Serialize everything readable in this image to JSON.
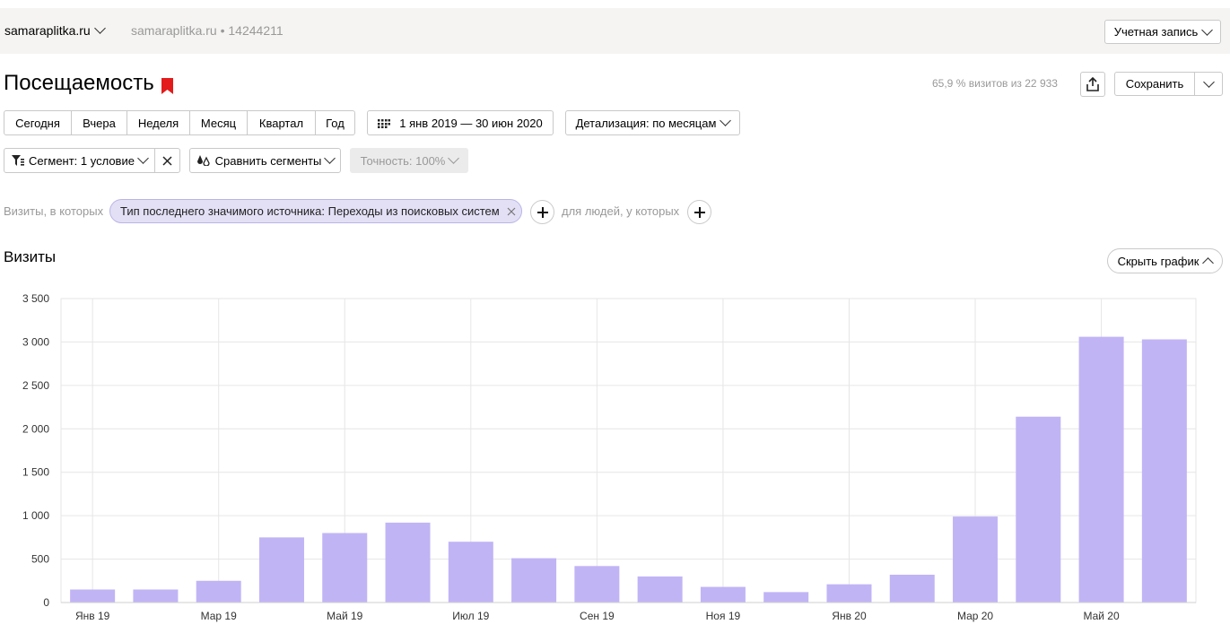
{
  "header": {
    "site": "samaraplitka.ru",
    "site_info": "samaraplitka.ru • 14244211",
    "account_label": "Учетная запись"
  },
  "report": {
    "title": "Посещаемость",
    "sample_text": "65,9 % визитов из 22 933",
    "save_label": "Сохранить"
  },
  "periods": [
    "Сегодня",
    "Вчера",
    "Неделя",
    "Месяц",
    "Квартал",
    "Год"
  ],
  "date_range": "1 янв 2019 — 30 июн 2020",
  "detail_label": "Детализация: по месяцам",
  "segment_label": "Сегмент: 1 условие",
  "compare_label": "Сравнить сегменты",
  "accuracy_label": "Точность: 100%",
  "filter": {
    "visits_prefix": "Визиты, в которых",
    "chip": "Тип последнего значимого источника: Переходы из поисковых систем",
    "people_prefix": "для людей, у которых"
  },
  "chart_section": {
    "title": "Визиты",
    "hide_label": "Скрыть график"
  },
  "colors": {
    "bar": "#c1b4f5",
    "bookmark": "#e31b1b",
    "chip_bg": "#e3e0f6"
  },
  "chart_data": {
    "type": "bar",
    "categories": [
      "Янв 19",
      "Фев 19",
      "Мар 19",
      "Апр 19",
      "Май 19",
      "Июн 19",
      "Июл 19",
      "Авг 19",
      "Сен 19",
      "Окт 19",
      "Ноя 19",
      "Дек 19",
      "Янв 20",
      "Фев 20",
      "Мар 20",
      "Апр 20",
      "Май 20",
      "Июн 20"
    ],
    "x_tick_labels": [
      "Янв 19",
      "",
      "Мар 19",
      "",
      "Май 19",
      "",
      "Июл 19",
      "",
      "Сен 19",
      "",
      "Ноя 19",
      "",
      "Янв 20",
      "",
      "Мар 20",
      "",
      "Май 20",
      ""
    ],
    "series": [
      {
        "values": [
          150,
          150,
          250,
          750,
          800,
          920,
          700,
          510,
          420,
          300,
          180,
          120,
          210,
          320,
          990,
          2140,
          3060,
          3030
        ]
      }
    ],
    "ylim": [
      0,
      3500
    ],
    "y_ticks": [
      0,
      500,
      1000,
      1500,
      2000,
      2500,
      3000,
      3500
    ],
    "y_tick_labels": [
      "0",
      "500",
      "1 000",
      "1 500",
      "2 000",
      "2 500",
      "3 000",
      "3 500"
    ],
    "grid": true
  }
}
